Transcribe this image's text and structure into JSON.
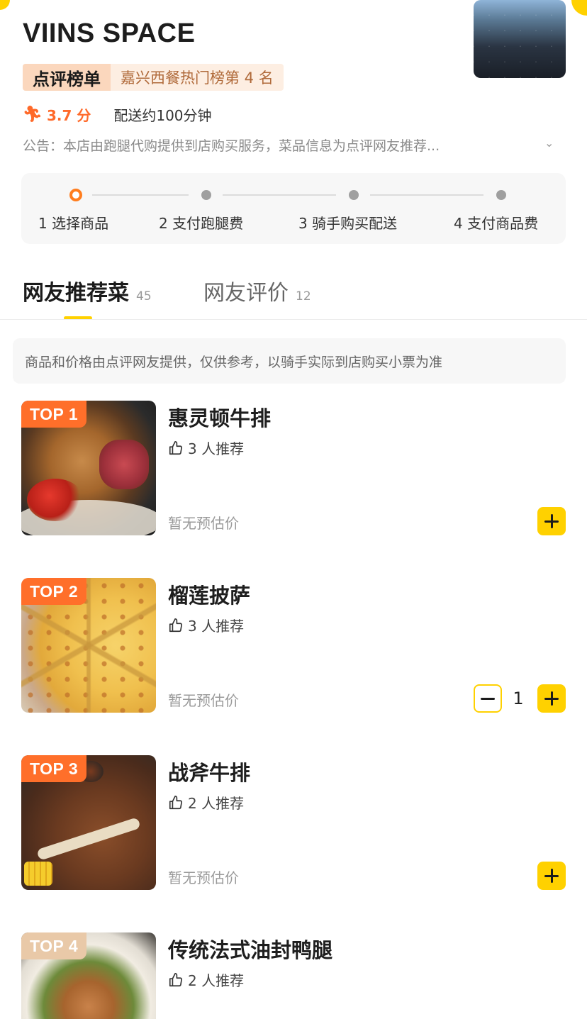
{
  "shop": {
    "name": "VIINS SPACE",
    "rank_tag": "点评榜单",
    "rank_text": "嘉兴西餐热门榜第 4 名",
    "rating": "3.7 分",
    "delivery": "配送约100分钟",
    "notice": "公告：本店由跑腿代购提供到店购买服务，菜品信息为点评网友推荐..."
  },
  "steps": [
    {
      "label": "1 选择商品",
      "active": true
    },
    {
      "label": "2 支付跑腿费",
      "active": false
    },
    {
      "label": "3 骑手购买配送",
      "active": false
    },
    {
      "label": "4 支付商品费",
      "active": false
    }
  ],
  "tabs": [
    {
      "label": "网友推荐菜",
      "count": "45",
      "selected": true
    },
    {
      "label": "网友评价",
      "count": "12",
      "selected": false
    }
  ],
  "disclaimer": "商品和价格由点评网友提供，仅供参考，以骑手实际到店购买小票为准",
  "dishes": [
    {
      "rank": "TOP 1",
      "name": "惠灵顿牛排",
      "likes": "3 人推荐",
      "price": "暂无预估价",
      "quantity": null
    },
    {
      "rank": "TOP 2",
      "name": "榴莲披萨",
      "likes": "3 人推荐",
      "price": "暂无预估价",
      "quantity": "1"
    },
    {
      "rank": "TOP 3",
      "name": "战斧牛排",
      "likes": "2 人推荐",
      "price": "暂无预估价",
      "quantity": null
    },
    {
      "rank": "TOP 4",
      "name": "传统法式油封鸭腿",
      "likes": "2 人推荐",
      "price": "",
      "quantity": null
    }
  ],
  "colors": {
    "accent_yellow": "#ffd100",
    "accent_orange": "#ff6f2a",
    "rating_orange": "#ff6a2a",
    "rank_bg": "#fbd7bd",
    "rank_text_color": "#b06a3a"
  },
  "icons": {
    "rating": "runner-icon",
    "likes": "thumbs-up-icon",
    "notice_expand": "chevron-down-icon",
    "add": "plus-icon",
    "remove": "minus-icon"
  }
}
